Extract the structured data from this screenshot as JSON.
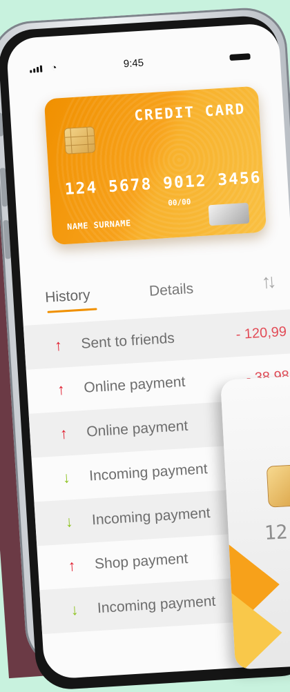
{
  "status_bar": {
    "time": "9:45",
    "signal_icon": "signal-bars-icon",
    "wifi_icon": "wifi-icon",
    "battery_icon": "battery-icon"
  },
  "card": {
    "title": "CREDIT CARD",
    "number": "124 5678 9012 3456",
    "expiry": "00/00",
    "holder": "NAME SURNAME",
    "color": "#f7a11a"
  },
  "tabs": [
    {
      "label": "History",
      "active": true
    },
    {
      "label": "Details",
      "active": false
    }
  ],
  "sort_icon": "sort-arrows-icon",
  "transactions": [
    {
      "direction": "up",
      "label": "Sent to friends",
      "amount": "- 120,99"
    },
    {
      "direction": "up",
      "label": "Online payment",
      "amount": "- 38,98"
    },
    {
      "direction": "up",
      "label": "Online payment",
      "amount": ""
    },
    {
      "direction": "down",
      "label": "Incoming payment",
      "amount": "+"
    },
    {
      "direction": "down",
      "label": "Incoming payment",
      "amount": "+"
    },
    {
      "direction": "up",
      "label": "Shop payment",
      "amount": ""
    },
    {
      "direction": "down",
      "label": "Incoming payment",
      "amount": ""
    }
  ],
  "overlay_card": {
    "number_fragment": "12"
  },
  "colors": {
    "up": "#e0182a",
    "down": "#8dc21f",
    "accent": "#f09000",
    "background_top": "#c8f2de",
    "background_bottom": "#6b3a45"
  }
}
